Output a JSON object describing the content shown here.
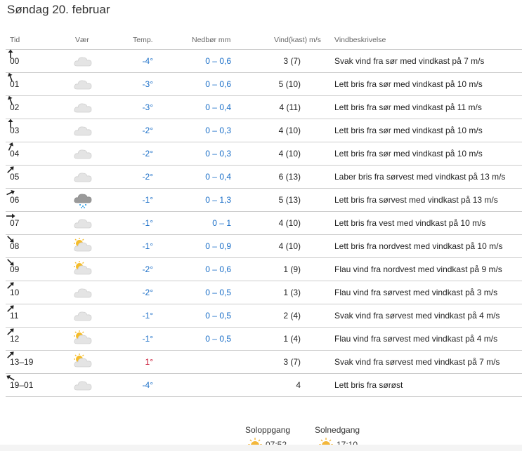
{
  "title": "Søndag 20. februar",
  "headers": {
    "tid": "Tid",
    "vaer": "Vær",
    "temp": "Temp.",
    "nedbor": "Nedbør mm",
    "vind": "Vind(kast) m/s",
    "beskrivelse": "Vindbeskrivelse"
  },
  "rows": [
    {
      "tid": "00",
      "icon": "cloud",
      "temp": "-4°",
      "nedbor": "0 – 0,6",
      "vind": "3 (7)",
      "dir": "north",
      "desc": "Svak vind fra sør med vindkast på 7 m/s"
    },
    {
      "tid": "01",
      "icon": "cloud",
      "temp": "-3°",
      "nedbor": "0 – 0,6",
      "vind": "5 (10)",
      "dir": "north-northwest",
      "desc": "Lett bris fra sør med vindkast på 10 m/s"
    },
    {
      "tid": "02",
      "icon": "cloud",
      "temp": "-3°",
      "nedbor": "0 – 0,4",
      "vind": "4 (11)",
      "dir": "north-northwest",
      "desc": "Lett bris fra sør med vindkast på 11 m/s"
    },
    {
      "tid": "03",
      "icon": "cloud",
      "temp": "-2°",
      "nedbor": "0 – 0,3",
      "vind": "4 (10)",
      "dir": "north",
      "desc": "Lett bris fra sør med vindkast på 10 m/s"
    },
    {
      "tid": "04",
      "icon": "cloud",
      "temp": "-2°",
      "nedbor": "0 – 0,3",
      "vind": "4 (10)",
      "dir": "north-northeast",
      "desc": "Lett bris fra sør med vindkast på 10 m/s"
    },
    {
      "tid": "05",
      "icon": "cloud",
      "temp": "-2°",
      "nedbor": "0 – 0,4",
      "vind": "6 (13)",
      "dir": "northeast",
      "desc": "Laber bris fra sørvest med vindkast på 13 m/s"
    },
    {
      "tid": "06",
      "icon": "snow-cloud",
      "temp": "-1°",
      "nedbor": "0 – 1,3",
      "vind": "5 (13)",
      "dir": "east-northeast",
      "desc": "Lett bris fra sørvest med vindkast på 13 m/s"
    },
    {
      "tid": "07",
      "icon": "cloud",
      "temp": "-1°",
      "nedbor": "0 – 1",
      "vind": "4 (10)",
      "dir": "east",
      "desc": "Lett bris fra vest med vindkast på 10 m/s"
    },
    {
      "tid": "08",
      "icon": "partly-cloudy",
      "temp": "-1°",
      "nedbor": "0 – 0,9",
      "vind": "4 (10)",
      "dir": "southeast",
      "desc": "Lett bris fra nordvest med vindkast på 10 m/s"
    },
    {
      "tid": "09",
      "icon": "partly-cloudy",
      "temp": "-2°",
      "nedbor": "0 – 0,6",
      "vind": "1 (9)",
      "dir": "southeast",
      "desc": "Flau vind fra nordvest med vindkast på 9 m/s"
    },
    {
      "tid": "10",
      "icon": "cloud",
      "temp": "-2°",
      "nedbor": "0 – 0,5",
      "vind": "1 (3)",
      "dir": "northeast",
      "desc": "Flau vind fra sørvest med vindkast på 3 m/s"
    },
    {
      "tid": "11",
      "icon": "cloud",
      "temp": "-1°",
      "nedbor": "0 – 0,5",
      "vind": "2 (4)",
      "dir": "northeast",
      "desc": "Svak vind fra sørvest med vindkast på 4 m/s"
    },
    {
      "tid": "12",
      "icon": "partly-cloudy",
      "temp": "-1°",
      "nedbor": "0 – 0,5",
      "vind": "1 (4)",
      "dir": "northeast",
      "desc": "Flau vind fra sørvest med vindkast på 4 m/s"
    },
    {
      "tid": "13–19",
      "icon": "partly-cloudy",
      "temp": "1°",
      "nedbor": "",
      "vind": "3 (7)",
      "dir": "northeast",
      "desc": "Svak vind fra sørvest med vindkast på 7 m/s"
    },
    {
      "tid": "19–01",
      "icon": "cloud",
      "temp": "-4°",
      "nedbor": "",
      "vind": "4",
      "dir": "northwest",
      "desc": "Lett bris fra sørøst"
    }
  ],
  "sun": {
    "rise_label": "Soloppgang",
    "rise_time": "07:52",
    "set_label": "Solnedgang",
    "set_time": "17:10"
  },
  "colors": {
    "cold": "#1b6fc8",
    "warm": "#c8102e",
    "precip": "#1b6fc8"
  }
}
